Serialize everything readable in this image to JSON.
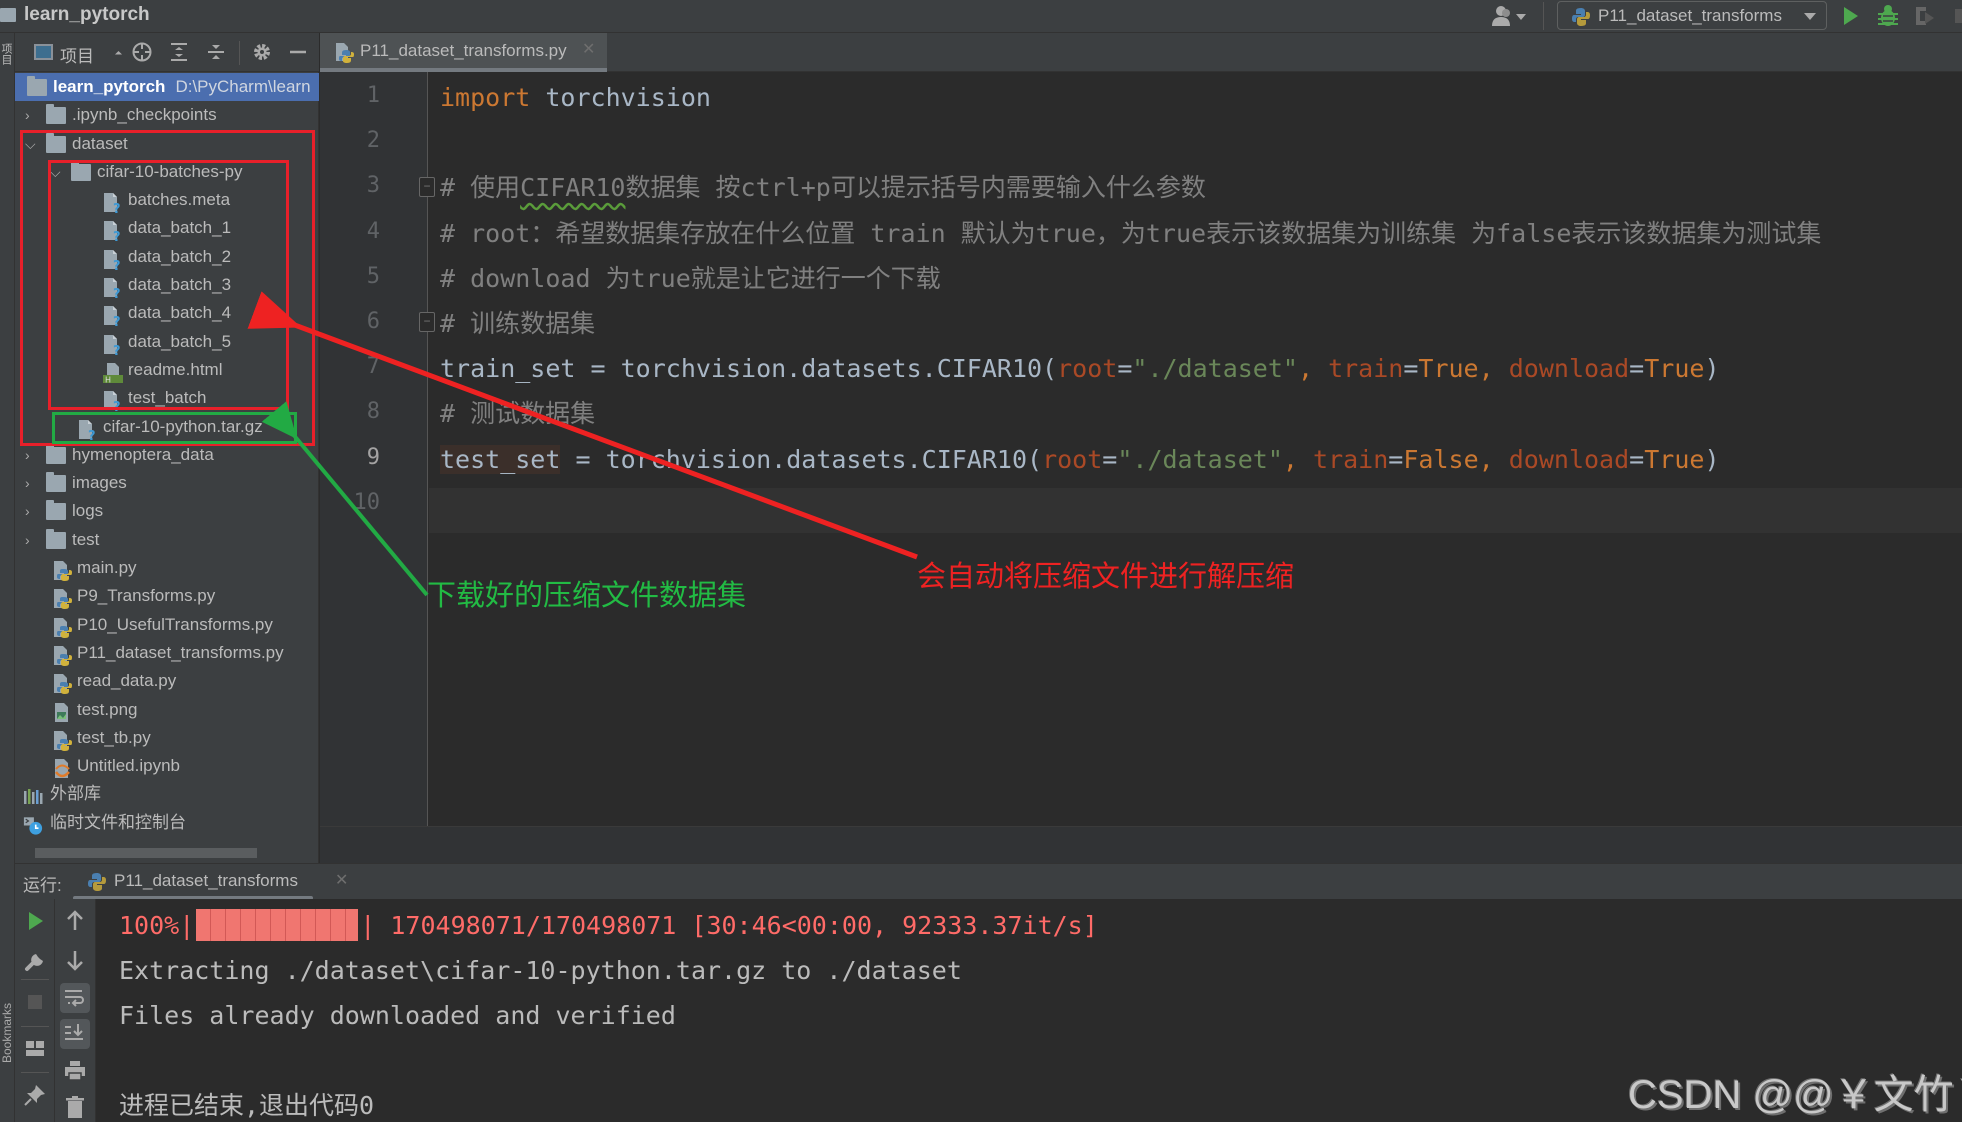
{
  "window": {
    "project_title": "learn_pytorch",
    "run_config": "P11_dataset_transforms"
  },
  "left_strip": {
    "project_label": "项目",
    "bookmarks_label": "Bookmarks"
  },
  "project_panel": {
    "view_label": "项目",
    "root": {
      "name": "learn_pytorch",
      "path": "D:\\PyCharm\\learn"
    },
    "tree": [
      {
        "name": ".ipynb_checkpoints",
        "kind": "folder",
        "depth": 1,
        "expanded": false
      },
      {
        "name": "dataset",
        "kind": "folder",
        "depth": 1,
        "expanded": true
      },
      {
        "name": "cifar-10-batches-py",
        "kind": "folder",
        "depth": 2,
        "expanded": true
      },
      {
        "name": "batches.meta",
        "kind": "unknown",
        "depth": 3
      },
      {
        "name": "data_batch_1",
        "kind": "unknown",
        "depth": 3
      },
      {
        "name": "data_batch_2",
        "kind": "unknown",
        "depth": 3
      },
      {
        "name": "data_batch_3",
        "kind": "unknown",
        "depth": 3
      },
      {
        "name": "data_batch_4",
        "kind": "unknown",
        "depth": 3
      },
      {
        "name": "data_batch_5",
        "kind": "unknown",
        "depth": 3
      },
      {
        "name": "readme.html",
        "kind": "html",
        "depth": 3
      },
      {
        "name": "test_batch",
        "kind": "unknown",
        "depth": 3
      },
      {
        "name": "cifar-10-python.tar.gz",
        "kind": "unknown",
        "depth": 2
      },
      {
        "name": "hymenoptera_data",
        "kind": "folder",
        "depth": 1,
        "expanded": false
      },
      {
        "name": "images",
        "kind": "folder",
        "depth": 1,
        "expanded": false
      },
      {
        "name": "logs",
        "kind": "folder",
        "depth": 1,
        "expanded": false
      },
      {
        "name": "test",
        "kind": "folder",
        "depth": 1,
        "expanded": false
      },
      {
        "name": "main.py",
        "kind": "python",
        "depth": 1
      },
      {
        "name": "P9_Transforms.py",
        "kind": "python",
        "depth": 1
      },
      {
        "name": "P10_UsefulTransforms.py",
        "kind": "python",
        "depth": 1
      },
      {
        "name": "P11_dataset_transforms.py",
        "kind": "python",
        "depth": 1
      },
      {
        "name": "read_data.py",
        "kind": "python",
        "depth": 1
      },
      {
        "name": "test.png",
        "kind": "image",
        "depth": 1
      },
      {
        "name": "test_tb.py",
        "kind": "python",
        "depth": 1
      },
      {
        "name": "Untitled.ipynb",
        "kind": "notebook",
        "depth": 1
      },
      {
        "name": "外部库",
        "kind": "libraries",
        "depth": 0
      },
      {
        "name": "临时文件和控制台",
        "kind": "scratches",
        "depth": 0
      }
    ]
  },
  "editor": {
    "tab_label": "P11_dataset_transforms.py",
    "current_line": 9,
    "line_numbers": [
      "1",
      "2",
      "3",
      "4",
      "5",
      "6",
      "7",
      "8",
      "9",
      "10"
    ],
    "lines": [
      [
        {
          "t": "import",
          "c": "kw"
        },
        {
          "t": " torchvision",
          "c": ""
        }
      ],
      [],
      [
        {
          "t": "# 使用",
          "c": "cm"
        },
        {
          "t": "CIFAR10",
          "c": "cm sq"
        },
        {
          "t": "数据集 按ctrl+p可以提示括号内需要输入什么参数",
          "c": "cm"
        }
      ],
      [
        {
          "t": "# root：希望数据集存放在什么位置 train 默认为true，为true表示该数据集为训练集 为false表示该数据集为测试集",
          "c": "cm"
        }
      ],
      [
        {
          "t": "# download 为true就是让它进行一个下载",
          "c": "cm"
        }
      ],
      [
        {
          "t": "# 训练数据集",
          "c": "cm"
        }
      ],
      [
        {
          "t": "train_set = torchvision.datasets.CIFAR10(",
          "c": ""
        },
        {
          "t": "root",
          "c": "param"
        },
        {
          "t": "=",
          "c": ""
        },
        {
          "t": "\"./dataset\"",
          "c": "str"
        },
        {
          "t": ", ",
          "c": "kw"
        },
        {
          "t": "train",
          "c": "param"
        },
        {
          "t": "=",
          "c": ""
        },
        {
          "t": "True",
          "c": "boolv"
        },
        {
          "t": ", ",
          "c": "kw"
        },
        {
          "t": "download",
          "c": "param"
        },
        {
          "t": "=",
          "c": ""
        },
        {
          "t": "True",
          "c": "boolv"
        },
        {
          "t": ")",
          "c": ""
        }
      ],
      [
        {
          "t": "# 测试数据集",
          "c": "cm"
        }
      ],
      [
        {
          "t": "test_set",
          "c": "hl-ident"
        },
        {
          "t": " = torchvision.datasets.CIFAR10(",
          "c": ""
        },
        {
          "t": "root",
          "c": "param"
        },
        {
          "t": "=",
          "c": ""
        },
        {
          "t": "\"./dataset\"",
          "c": "str"
        },
        {
          "t": ", ",
          "c": "kw"
        },
        {
          "t": "train",
          "c": "param"
        },
        {
          "t": "=",
          "c": ""
        },
        {
          "t": "False",
          "c": "boolv"
        },
        {
          "t": ", ",
          "c": "kw"
        },
        {
          "t": "download",
          "c": "param"
        },
        {
          "t": "=",
          "c": ""
        },
        {
          "t": "True",
          "c": "boolv"
        },
        {
          "t": ")",
          "c": ""
        }
      ],
      []
    ]
  },
  "run_panel": {
    "label": "运行:",
    "tab_label": "P11_dataset_transforms",
    "progress": {
      "percent_label": "100%|",
      "fraction": 1.0,
      "suffix": "| 170498071/170498071 [30:46<00:00, 92333.37it/s]"
    },
    "lines": [
      "Extracting ./dataset\\cifar-10-python.tar.gz to ./dataset",
      "Files already downloaded and verified",
      "",
      "进程已结束,退出代码0"
    ]
  },
  "annotations": {
    "green_text": "下载好的压缩文件数据集",
    "red_text": "会自动将压缩文件进行解压缩",
    "green_color": "#22bb44",
    "red_color": "#ee2222"
  },
  "watermark": "CSDN @@￥文竹￥"
}
